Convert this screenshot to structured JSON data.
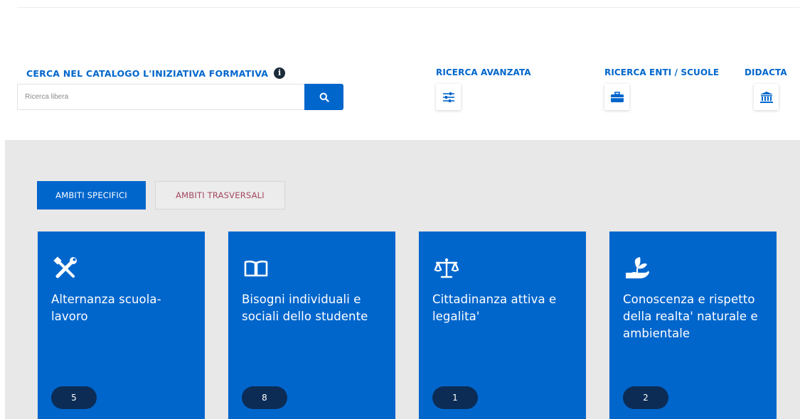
{
  "search": {
    "title": "CERCA NEL CATALOGO L'INIZIATIVA FORMATIVA",
    "info_icon": "info-icon",
    "placeholder": "Ricerca libera",
    "button_icon": "search-icon"
  },
  "quick_links": [
    {
      "label": "RICERCA AVANZATA",
      "icon": "sliders-icon"
    },
    {
      "label": "RICERCA ENTI / SCUOLE",
      "icon": "briefcase-icon"
    },
    {
      "label": "DIDACTA",
      "icon": "institution-icon"
    }
  ],
  "tabs": [
    {
      "label": "AMBITI SPECIFICI",
      "active": true
    },
    {
      "label": "AMBITI TRASVERSALI",
      "active": false
    }
  ],
  "cards": [
    {
      "title": "Alternanza scuola-lavoro",
      "count": "5",
      "icon": "tools-icon"
    },
    {
      "title": "Bisogni individuali e sociali dello studente",
      "count": "8",
      "icon": "open-book-icon"
    },
    {
      "title": "Cittadinanza attiva e legalita'",
      "count": "1",
      "icon": "scales-icon"
    },
    {
      "title": "Conoscenza e rispetto della realta' naturale e ambientale",
      "count": "2",
      "icon": "hand-plant-icon"
    }
  ],
  "colors": {
    "primary": "#0066cc",
    "badge": "#0c2c56",
    "background_band": "#e8e8e8",
    "inactive_tab_text": "#a5475f"
  }
}
